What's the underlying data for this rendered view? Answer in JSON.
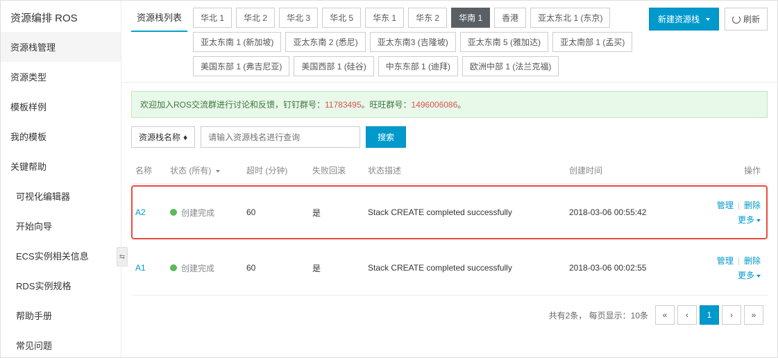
{
  "product_title": "资源编排 ROS",
  "sidebar": {
    "items": [
      {
        "label": "资源栈管理",
        "active": true
      },
      {
        "label": "资源类型"
      },
      {
        "label": "模板样例"
      },
      {
        "label": "我的模板"
      },
      {
        "label": "关键帮助"
      }
    ],
    "sub_items": [
      {
        "label": "可视化编辑器"
      },
      {
        "label": "开始向导"
      },
      {
        "label": "ECS实例相关信息"
      },
      {
        "label": "RDS实例规格"
      },
      {
        "label": "帮助手册"
      },
      {
        "label": "常见问题"
      }
    ]
  },
  "header": {
    "tab_label": "资源栈列表",
    "regions": [
      "华北 1",
      "华北 2",
      "华北 3",
      "华北 5",
      "华东 1",
      "华东 2",
      "华南 1",
      "香港",
      "亚太东北 1 (东京)",
      "亚太东南 1 (新加坡)",
      "亚太东南 2 (悉尼)",
      "亚太东南3 (吉隆坡)",
      "亚太东南 5 (雅加达)",
      "亚太南部 1 (孟买)",
      "美国东部 1 (弗吉尼亚)",
      "美国西部 1 (硅谷)",
      "中东东部 1 (迪拜)",
      "欧洲中部 1 (法兰克福)"
    ],
    "active_region_index": 6,
    "create_btn": "新建资源栈",
    "refresh_btn": "刷新"
  },
  "banner": {
    "prefix": "欢迎加入ROS交流群进行讨论和反馈，钉钉群号：",
    "num1": "11783495",
    "mid": "。旺旺群号：",
    "num2": "1496006086",
    "suffix": "。"
  },
  "search": {
    "select_label": "资源栈名称",
    "placeholder": "请输入资源栈名进行查询",
    "button": "搜索"
  },
  "table": {
    "headers": {
      "name": "名称",
      "status": "状态 (所有)",
      "timeout": "超时 (分钟)",
      "rollback": "失败回滚",
      "desc": "状态描述",
      "time": "创建时间",
      "ops": "操作"
    },
    "rows": [
      {
        "name": "A2",
        "status": "创建完成",
        "timeout": "60",
        "rollback": "是",
        "desc": "Stack CREATE completed successfully",
        "time": "2018-03-06 00:55:42",
        "highlight": true
      },
      {
        "name": "A1",
        "status": "创建完成",
        "timeout": "60",
        "rollback": "是",
        "desc": "Stack CREATE completed successfully",
        "time": "2018-03-06 00:02:55",
        "highlight": false
      }
    ],
    "ops_labels": {
      "manage": "管理",
      "delete": "删除",
      "more": "更多"
    }
  },
  "pager": {
    "summary_prefix": "共有",
    "total": "2",
    "summary_mid": "条，  每页显示：",
    "page_size": "10条",
    "current": "1"
  }
}
